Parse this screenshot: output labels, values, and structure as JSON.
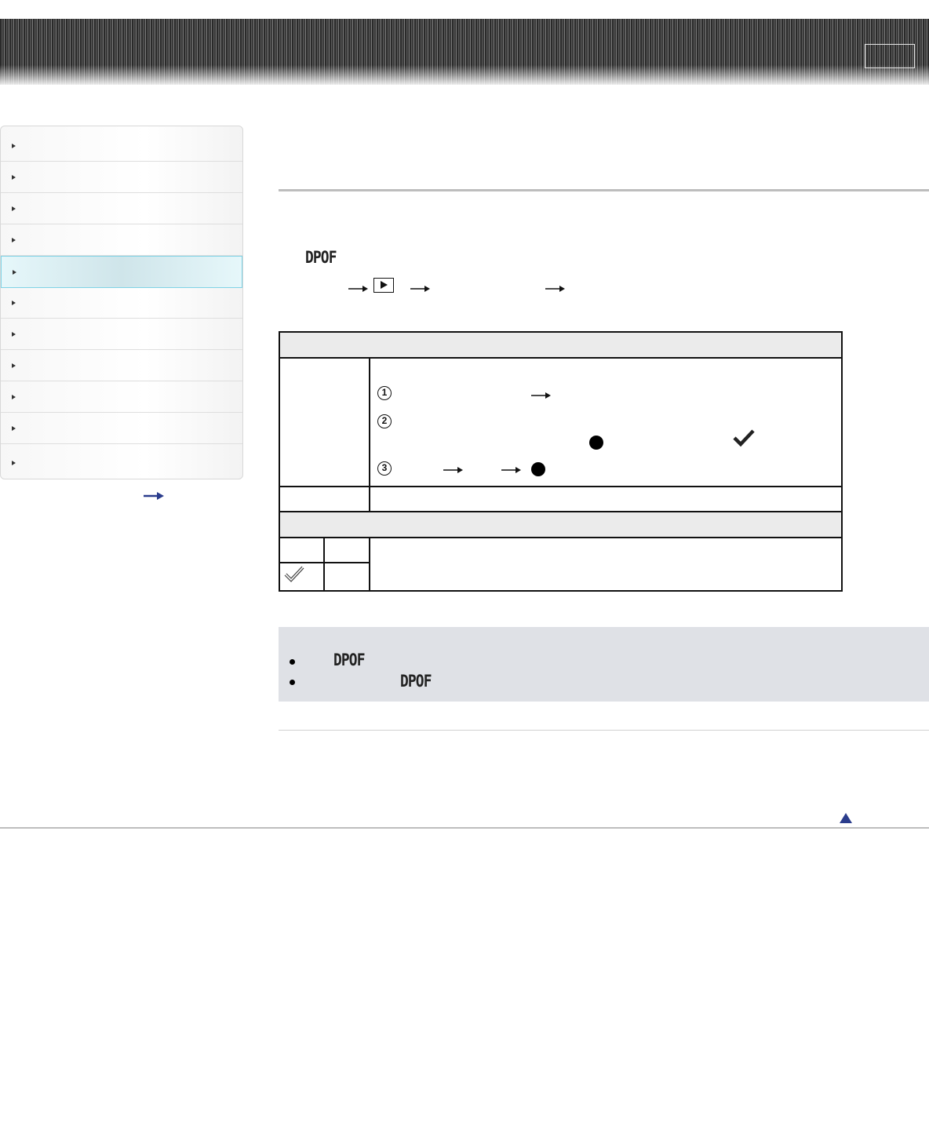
{
  "header": {
    "button_label": ""
  },
  "sidebar": {
    "items": [
      {
        "label": ""
      },
      {
        "label": ""
      },
      {
        "label": ""
      },
      {
        "label": ""
      },
      {
        "label": "",
        "active": true
      },
      {
        "label": ""
      },
      {
        "label": ""
      },
      {
        "label": ""
      },
      {
        "label": ""
      },
      {
        "label": ""
      },
      {
        "label": ""
      }
    ],
    "more_link_icon": "right-arrow-icon"
  },
  "main": {
    "dpof_label": "DPOF",
    "path_icons": [
      "right-arrow-icon",
      "playback-icon",
      "right-arrow-icon",
      "right-arrow-icon"
    ],
    "table": {
      "step_numbers": [
        "1",
        "2",
        "3"
      ],
      "icons": [
        "right-arrow-icon",
        "filled-dot-icon",
        "checkmark-icon",
        "right-arrow-icon",
        "right-arrow-icon",
        "filled-dot-icon",
        "print-mark-icon"
      ]
    },
    "notes": [
      {
        "dpof": "DPOF"
      },
      {
        "dpof": "DPOF"
      }
    ]
  },
  "footer": {
    "back_to_top_icon": "up-triangle-icon",
    "accent_color": "#2a3c8c"
  }
}
